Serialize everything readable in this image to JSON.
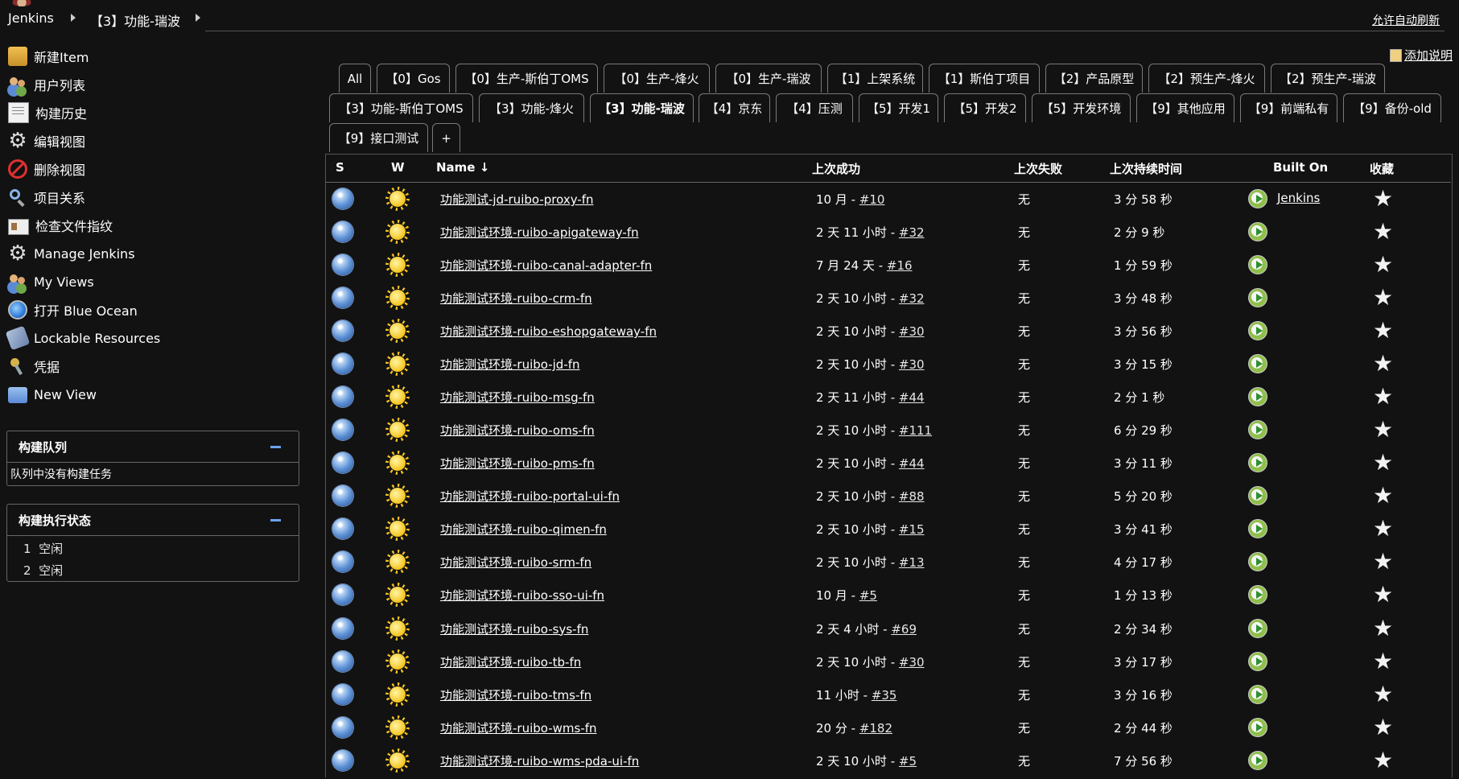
{
  "breadcrumb": {
    "home": "Jenkins",
    "current": "【3】功能-瑞波",
    "auto_refresh": "允许自动刷新"
  },
  "sidebar": {
    "tasks": [
      {
        "label": "新建Item",
        "icon": "folder-icon"
      },
      {
        "label": "用户列表",
        "icon": "people-icon"
      },
      {
        "label": "构建历史",
        "icon": "notepad-icon"
      },
      {
        "label": "编辑视图",
        "icon": "gear-icon"
      },
      {
        "label": "删除视图",
        "icon": "no-entry-icon"
      },
      {
        "label": "项目关系",
        "icon": "search-icon"
      },
      {
        "label": "检查文件指纹",
        "icon": "fingerprint-card-icon"
      },
      {
        "label": "Manage Jenkins",
        "icon": "gear-icon"
      },
      {
        "label": "My Views",
        "icon": "people-icon"
      },
      {
        "label": "打开 Blue Ocean",
        "icon": "blue-ocean-icon"
      },
      {
        "label": "Lockable Resources",
        "icon": "lock-icon"
      },
      {
        "label": "凭据",
        "icon": "keys-icon"
      },
      {
        "label": "New View",
        "icon": "blue-folder-icon"
      }
    ],
    "build_queue": {
      "title": "构建队列",
      "empty": "队列中没有构建任务"
    },
    "executors": {
      "title": "构建执行状态",
      "rows": [
        {
          "num": "1",
          "state": "空闲"
        },
        {
          "num": "2",
          "state": "空闲"
        }
      ]
    }
  },
  "add_description": "添加说明",
  "tabs": [
    "All",
    "【0】Gos",
    "【0】生产-斯伯丁OMS",
    "【0】生产-烽火",
    "【0】生产-瑞波",
    "【1】上架系统",
    "【1】斯伯丁项目",
    "【2】产品原型",
    "【2】预生产-烽火",
    "【2】预生产-瑞波",
    "【3】功能-斯伯丁OMS",
    "【3】功能-烽火",
    "【3】功能-瑞波",
    "【4】京东",
    "【4】压测",
    "【5】开发1",
    "【5】开发2",
    "【5】开发环境",
    "【9】其他应用",
    "【9】前端私有",
    "【9】备份-old",
    "【9】接口测试",
    "+"
  ],
  "active_tab": "【3】功能-瑞波",
  "table": {
    "headers": {
      "s": "S",
      "w": "W",
      "name": "Name ↓",
      "last_success": "上次成功",
      "last_failure": "上次失败",
      "last_duration": "上次持续时间",
      "built_on": "Built On",
      "fav": "收藏"
    },
    "rows": [
      {
        "name": "功能测试-jd-ruibo-proxy-fn",
        "ls_time": "10 月 - ",
        "ls_build": "#10",
        "lf": "无",
        "dur": "3 分 58 秒",
        "built_on": "Jenkins"
      },
      {
        "name": "功能测试环境-ruibo-apigateway-fn",
        "ls_time": "2 天 11 小时 - ",
        "ls_build": "#32",
        "lf": "无",
        "dur": "2 分 9 秒",
        "built_on": ""
      },
      {
        "name": "功能测试环境-ruibo-canal-adapter-fn",
        "ls_time": "7 月 24 天 - ",
        "ls_build": "#16",
        "lf": "无",
        "dur": "1 分 59 秒",
        "built_on": ""
      },
      {
        "name": "功能测试环境-ruibo-crm-fn",
        "ls_time": "2 天 10 小时 - ",
        "ls_build": "#32",
        "lf": "无",
        "dur": "3 分 48 秒",
        "built_on": ""
      },
      {
        "name": "功能测试环境-ruibo-eshopgateway-fn",
        "ls_time": "2 天 10 小时 - ",
        "ls_build": "#30",
        "lf": "无",
        "dur": "3 分 56 秒",
        "built_on": ""
      },
      {
        "name": "功能测试环境-ruibo-jd-fn",
        "ls_time": "2 天 10 小时 - ",
        "ls_build": "#30",
        "lf": "无",
        "dur": "3 分 15 秒",
        "built_on": ""
      },
      {
        "name": "功能测试环境-ruibo-msg-fn",
        "ls_time": "2 天 11 小时 - ",
        "ls_build": "#44",
        "lf": "无",
        "dur": "2 分 1 秒",
        "built_on": ""
      },
      {
        "name": "功能测试环境-ruibo-oms-fn",
        "ls_time": "2 天 10 小时 - ",
        "ls_build": "#111",
        "lf": "无",
        "dur": "6 分 29 秒",
        "built_on": ""
      },
      {
        "name": "功能测试环境-ruibo-pms-fn",
        "ls_time": "2 天 10 小时 - ",
        "ls_build": "#44",
        "lf": "无",
        "dur": "3 分 11 秒",
        "built_on": ""
      },
      {
        "name": "功能测试环境-ruibo-portal-ui-fn",
        "ls_time": "2 天 10 小时 - ",
        "ls_build": "#88",
        "lf": "无",
        "dur": "5 分 20 秒",
        "built_on": ""
      },
      {
        "name": "功能测试环境-ruibo-qimen-fn",
        "ls_time": "2 天 10 小时 - ",
        "ls_build": "#15",
        "lf": "无",
        "dur": "3 分 41 秒",
        "built_on": ""
      },
      {
        "name": "功能测试环境-ruibo-srm-fn",
        "ls_time": "2 天 10 小时 - ",
        "ls_build": "#13",
        "lf": "无",
        "dur": "4 分 17 秒",
        "built_on": ""
      },
      {
        "name": "功能测试环境-ruibo-sso-ui-fn",
        "ls_time": "10 月 - ",
        "ls_build": "#5",
        "lf": "无",
        "dur": "1 分 13 秒",
        "built_on": ""
      },
      {
        "name": "功能测试环境-ruibo-sys-fn",
        "ls_time": "2 天 4 小时 - ",
        "ls_build": "#69",
        "lf": "无",
        "dur": "2 分 34 秒",
        "built_on": ""
      },
      {
        "name": "功能测试环境-ruibo-tb-fn",
        "ls_time": "2 天 10 小时 - ",
        "ls_build": "#30",
        "lf": "无",
        "dur": "3 分 17 秒",
        "built_on": ""
      },
      {
        "name": "功能测试环境-ruibo-tms-fn",
        "ls_time": "11 小时 - ",
        "ls_build": "#35",
        "lf": "无",
        "dur": "3 分 16 秒",
        "built_on": ""
      },
      {
        "name": "功能测试环境-ruibo-wms-fn",
        "ls_time": "20 分 - ",
        "ls_build": "#182",
        "lf": "无",
        "dur": "2 分 44 秒",
        "built_on": ""
      },
      {
        "name": "功能测试环境-ruibo-wms-pda-ui-fn",
        "ls_time": "2 天 10 小时 - ",
        "ls_build": "#5",
        "lf": "无",
        "dur": "7 分 56 秒",
        "built_on": ""
      }
    ]
  },
  "icons": {
    "status": "blue-ball-icon",
    "weather": "sunny-icon",
    "build": "schedule-build-icon",
    "favorite": "star-icon"
  }
}
